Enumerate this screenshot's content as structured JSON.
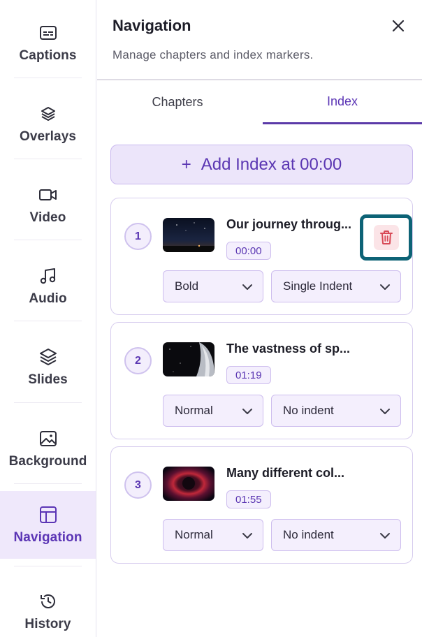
{
  "sidebar": {
    "items": [
      {
        "label": "Captions",
        "icon": "captions-icon"
      },
      {
        "label": "Overlays",
        "icon": "layers-icon"
      },
      {
        "label": "Video",
        "icon": "video-camera-icon"
      },
      {
        "label": "Audio",
        "icon": "music-note-icon"
      },
      {
        "label": "Slides",
        "icon": "slides-stack-icon"
      },
      {
        "label": "Background",
        "icon": "image-icon"
      },
      {
        "label": "Navigation",
        "icon": "layout-icon",
        "active": true
      },
      {
        "label": "History",
        "icon": "history-icon"
      }
    ]
  },
  "panel": {
    "title": "Navigation",
    "subtitle": "Manage chapters and index markers.",
    "tabs": [
      {
        "label": "Chapters",
        "active": false
      },
      {
        "label": "Index",
        "active": true
      }
    ],
    "add_button": {
      "icon": "+",
      "label": "Add Index at 00:00"
    }
  },
  "index_items": [
    {
      "number": "1",
      "title": "Our journey throug...",
      "time": "00:00",
      "style": "Bold",
      "indent": "Single Indent",
      "thumb": "night-sky"
    },
    {
      "number": "2",
      "title": "The vastness of sp...",
      "time": "01:19",
      "style": "Normal",
      "indent": "No indent",
      "thumb": "planet-space"
    },
    {
      "number": "3",
      "title": "Many different col...",
      "time": "01:55",
      "style": "Normal",
      "indent": "No indent",
      "thumb": "red-nebula"
    }
  ],
  "colors": {
    "accent": "#5b35b5",
    "active_bg": "#efe8fb",
    "delete": "#d84a57",
    "highlight": "#0d6376"
  }
}
